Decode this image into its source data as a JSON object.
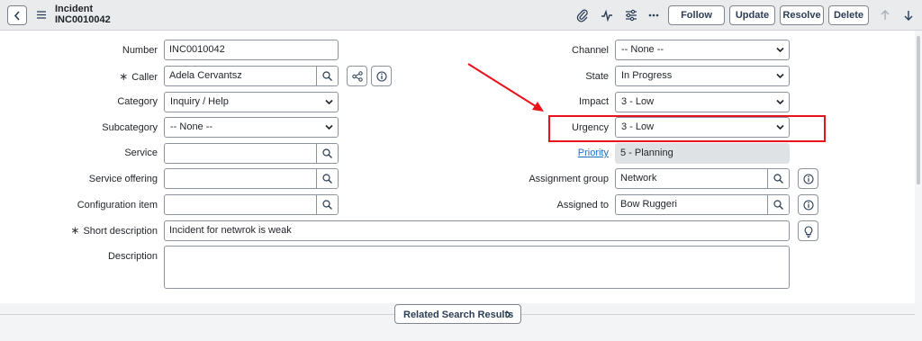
{
  "header": {
    "title": "Incident",
    "number": "INC0010042",
    "buttons": {
      "follow": "Follow",
      "update": "Update",
      "resolve": "Resolve",
      "delete": "Delete"
    }
  },
  "form": {
    "number": {
      "label": "Number",
      "value": "INC0010042"
    },
    "caller": {
      "label": "Caller",
      "required": "∗",
      "value": "Adela Cervantsz"
    },
    "category": {
      "label": "Category",
      "value": "Inquiry / Help"
    },
    "subcategory": {
      "label": "Subcategory",
      "value": "-- None --"
    },
    "service": {
      "label": "Service",
      "value": ""
    },
    "service_offering": {
      "label": "Service offering",
      "value": ""
    },
    "configuration_item": {
      "label": "Configuration item",
      "value": ""
    },
    "short_description": {
      "label": "Short description",
      "required": "∗",
      "value": "Incident for netwrok is weak"
    },
    "description": {
      "label": "Description",
      "value": ""
    },
    "channel": {
      "label": "Channel",
      "value": "-- None --"
    },
    "state": {
      "label": "State",
      "value": "In Progress"
    },
    "impact": {
      "label": "Impact",
      "value": "3 - Low"
    },
    "urgency": {
      "label": "Urgency",
      "value": "3 - Low"
    },
    "priority": {
      "label": "Priority",
      "value": "5 - Planning"
    },
    "assignment_group": {
      "label": "Assignment group",
      "value": "Network"
    },
    "assigned_to": {
      "label": "Assigned to",
      "value": "Bow Ruggeri"
    }
  },
  "related": {
    "label": "Related Search Results"
  },
  "annotation": {
    "color": "#e8121c"
  }
}
